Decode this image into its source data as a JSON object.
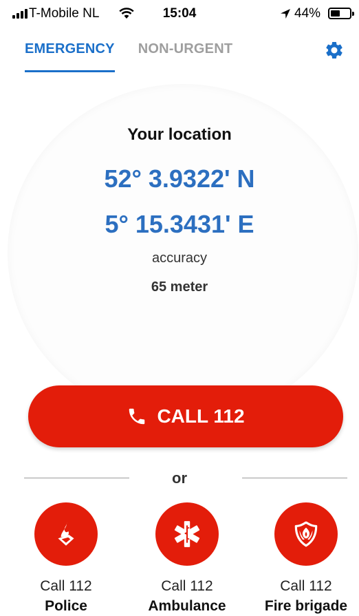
{
  "status_bar": {
    "carrier": "T-Mobile NL",
    "time": "15:04",
    "battery": "44%",
    "battery_level": 0.44
  },
  "tabs": [
    {
      "label": "EMERGENCY",
      "active": true
    },
    {
      "label": "NON-URGENT",
      "active": false
    }
  ],
  "settings_icon": "gear-icon",
  "location": {
    "title": "Your location",
    "latitude": "52° 3.9322' N",
    "longitude": "5° 15.3431' E",
    "accuracy_label": "accuracy",
    "accuracy_value": "65 meter"
  },
  "call_button": {
    "label": "CALL 112",
    "icon": "phone-icon"
  },
  "divider": {
    "label": "or"
  },
  "services": [
    {
      "line1": "Call 112",
      "line2": "Police",
      "icon": "police-icon"
    },
    {
      "line1": "Call 112",
      "line2": "Ambulance",
      "icon": "star-of-life-icon"
    },
    {
      "line1": "Call 112",
      "line2": "Fire brigade",
      "icon": "fire-brigade-icon"
    }
  ],
  "colors": {
    "accent_blue": "#1a6fc9",
    "coordinate_blue": "#2c6fc0",
    "emergency_red": "#e31d0a",
    "inactive_gray": "#9e9e9e"
  }
}
